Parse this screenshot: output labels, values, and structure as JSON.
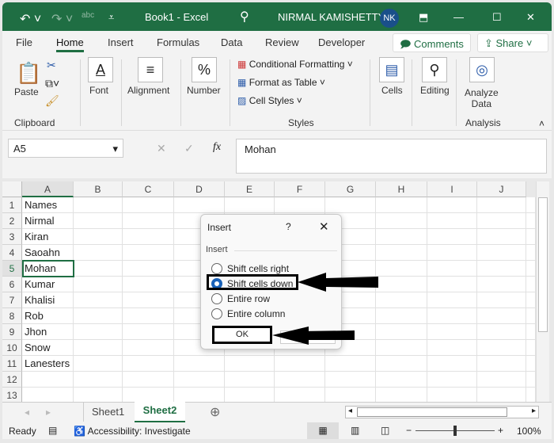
{
  "titlebar": {
    "doc": "Book1",
    "app": "Excel",
    "separator": "-",
    "user": "NIRMAL KAMISHETTY",
    "initials": "NK"
  },
  "tabs": [
    "File",
    "Home",
    "Insert",
    "Formulas",
    "Data",
    "Review",
    "Developer"
  ],
  "comments": "Comments",
  "share": "Share",
  "ribbon": {
    "paste": "Paste",
    "clipboard": "Clipboard",
    "font": "Font",
    "alignment": "Alignment",
    "number": "Number",
    "cond": "Conditional Formatting",
    "fmt_table": "Format as Table",
    "cell_styles": "Cell Styles",
    "styles": "Styles",
    "cells": "Cells",
    "editing": "Editing",
    "analyze1": "Analyze",
    "analyze2": "Data",
    "analysis": "Analysis"
  },
  "namebox": "A5",
  "formula": "Mohan",
  "fx": "fx",
  "columns": [
    "A",
    "B",
    "C",
    "D",
    "E",
    "F",
    "G",
    "H",
    "I",
    "J"
  ],
  "rows": [
    "1",
    "2",
    "3",
    "4",
    "5",
    "6",
    "7",
    "8",
    "9",
    "10",
    "11",
    "12",
    "13"
  ],
  "colA": [
    "Names",
    "Nirmal",
    "Kiran",
    "Saoahn",
    "Mohan",
    "Kumar",
    "Khalisi",
    "Rob",
    "Jhon",
    "Snow",
    "Lanesters",
    "",
    ""
  ],
  "dialog": {
    "title": "Insert",
    "help": "?",
    "group": "Insert",
    "options": [
      "Shift cells right",
      "Shift cells down",
      "Entire row",
      "Entire column"
    ],
    "selected": 1,
    "ok": "OK"
  },
  "sheets": [
    "Sheet1",
    "Sheet2"
  ],
  "active_sheet": "Sheet2",
  "status": {
    "ready": "Ready",
    "accessibility": "Accessibility: Investigate",
    "zoom": "100%",
    "minus": "−",
    "plus": "+"
  }
}
